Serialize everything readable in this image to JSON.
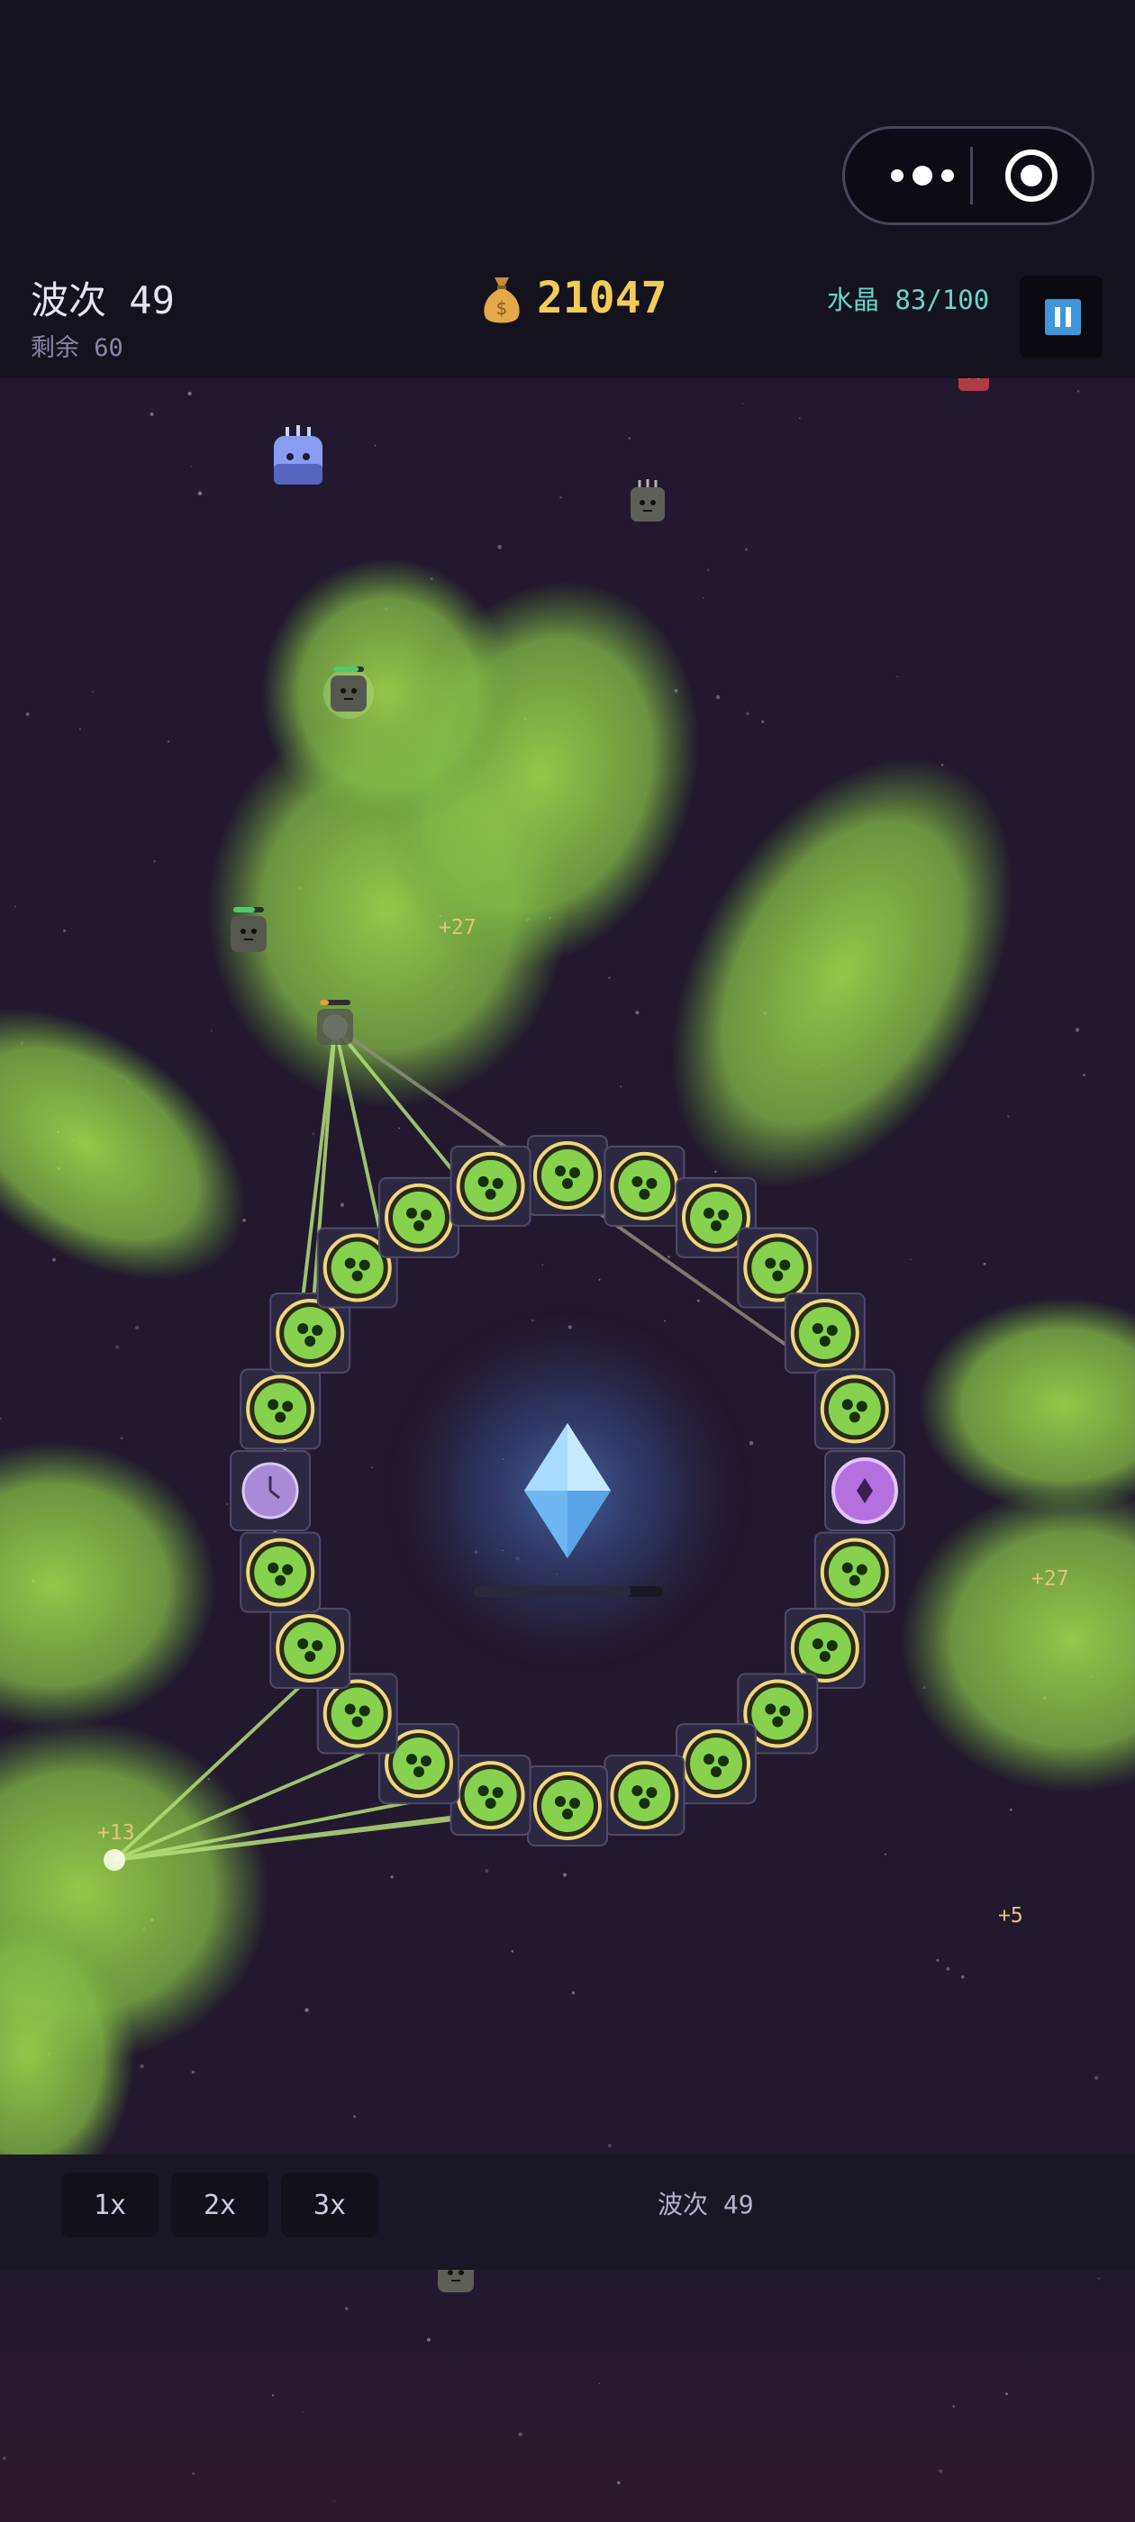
{
  "hud": {
    "wave_label": "波次 49",
    "remaining_label": "剩余 60",
    "gold": "21047",
    "crystal_label": "水晶 83/100"
  },
  "floating_texts": [
    "+27",
    "+27",
    "+13",
    "+5"
  ],
  "crystal_health": 0.83,
  "speed_buttons": [
    "1x",
    "2x",
    "3x"
  ],
  "bottom_bar": {
    "wave_label": "波次 49"
  },
  "tower_count": 24,
  "colors": {
    "background": "#22192e",
    "gold": "#f1cc58",
    "crystal_text": "#69d6c7",
    "poison_cloud": "#9bd84a",
    "tower_green": "#86d24e",
    "tower_ring": "#f0d77a",
    "special_tower": "#b570e0",
    "crystal": "#8fd0ff",
    "pause": "#3f95d8"
  },
  "icons": [
    "money-bag-icon",
    "pause-icon",
    "more-dots-icon",
    "target-icon",
    "crystal-icon",
    "clock-icon",
    "diamond-icon",
    "spore-icon"
  ]
}
